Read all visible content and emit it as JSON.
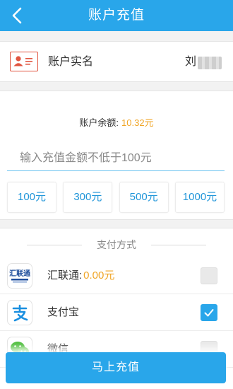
{
  "header": {
    "title": "账户充值",
    "back_icon": "back-arrow-icon",
    "background": "#29a6ea"
  },
  "account": {
    "icon": "id-card-icon",
    "label": "账户实名",
    "name_visible": "刘"
  },
  "balance": {
    "label": "账户余额:",
    "value": "10.32元",
    "value_color": "#f0a526"
  },
  "amount_input": {
    "value": "",
    "placeholder": "输入充值金额不低于100元"
  },
  "quick_amounts": [
    {
      "label": "100元"
    },
    {
      "label": "300元"
    },
    {
      "label": "500元"
    },
    {
      "label": "1000元"
    }
  ],
  "payment": {
    "title": "支付方式",
    "methods": [
      {
        "name": "汇联通:",
        "amount": "0.00元",
        "icon": "huiliantong-logo-icon",
        "logo_text": "汇联通",
        "checked": false
      },
      {
        "name": "支付宝",
        "amount": "",
        "icon": "alipay-logo-icon",
        "checked": true
      },
      {
        "name": "微信",
        "amount": "",
        "icon": "wechat-logo-icon",
        "checked": false
      }
    ]
  },
  "submit": {
    "label": "马上充值"
  }
}
